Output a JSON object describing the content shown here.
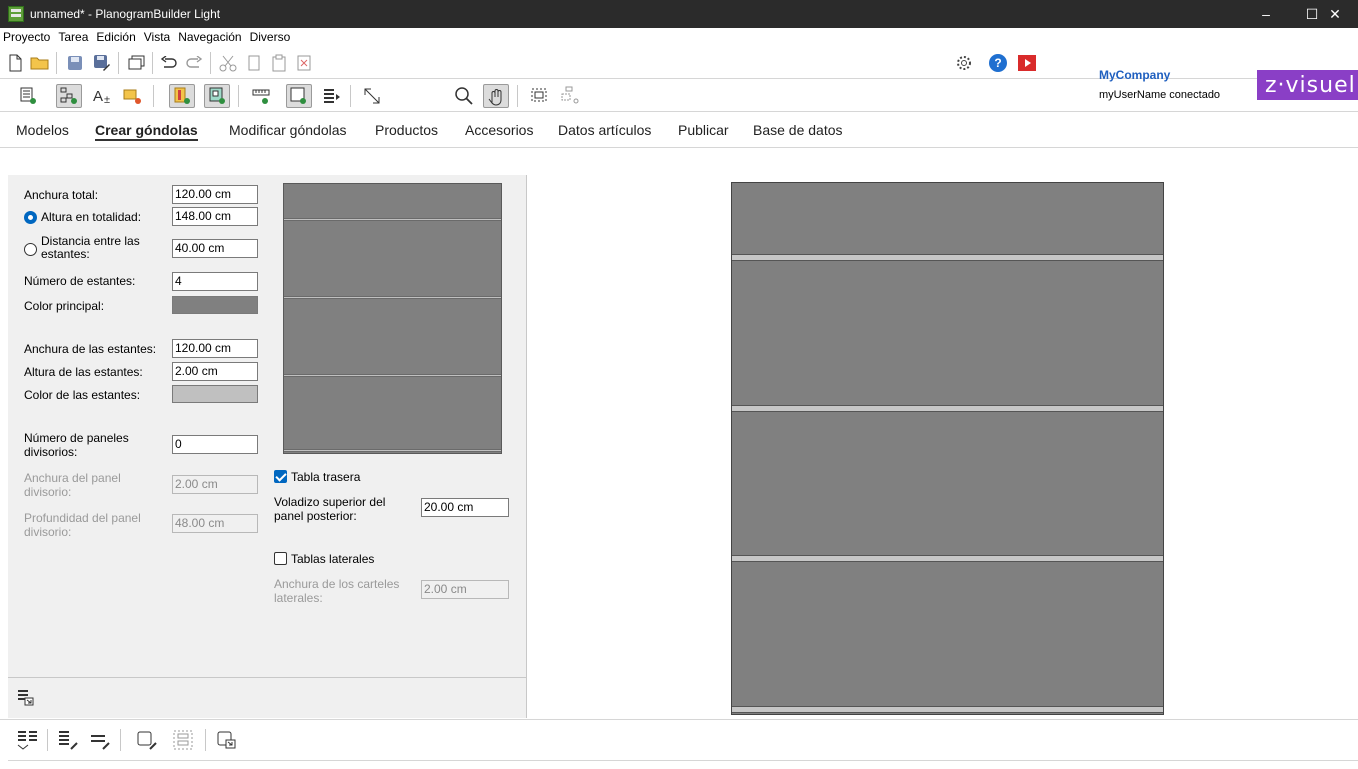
{
  "window": {
    "title": "unnamed* - PlanogramBuilder Light",
    "controls": {
      "minimize": "–",
      "maximize": "☐",
      "close": "✕"
    }
  },
  "menu": [
    "Proyecto",
    "Tarea",
    "Edición",
    "Vista",
    "Navegación",
    "Diverso"
  ],
  "company": {
    "name": "MyCompany",
    "user": "myUserName conectado",
    "logo": "z·visuel"
  },
  "tabs": [
    "Modelos",
    "Crear góndolas",
    "Modificar góndolas",
    "Productos",
    "Accesorios",
    "Datos artículos",
    "Publicar",
    "Base de datos"
  ],
  "active_tab": "Crear góndolas",
  "form": {
    "total_width_label": "Anchura total:",
    "total_width_value": "120.00 cm",
    "total_height_label": "Altura en totalidad:",
    "total_height_value": "148.00 cm",
    "shelf_distance_label_1": "Distancia entre las",
    "shelf_distance_label_2": "estantes:",
    "shelf_distance_value": "40.00 cm",
    "num_shelves_label": "Número de estantes:",
    "num_shelves_value": "4",
    "main_color_label": "Color principal:",
    "main_color": "#808080",
    "shelf_width_label": "Anchura de las estantes:",
    "shelf_width_value": "120.00 cm",
    "shelf_height_label": "Altura de las estantes:",
    "shelf_height_value": "2.00 cm",
    "shelf_color_label": "Color de las estantes:",
    "shelf_color": "#c0c0c0",
    "num_dividers_label_1": "Número de paneles",
    "num_dividers_label_2": "divisorios:",
    "num_dividers_value": "0",
    "divider_width_label_1": "Anchura del panel",
    "divider_width_label_2": "divisorio:",
    "divider_width_value": "2.00 cm",
    "divider_depth_label_1": "Profundidad del panel",
    "divider_depth_label_2": "divisorio:",
    "divider_depth_value": "48.00 cm",
    "back_board_label": "Tabla trasera",
    "overhang_label_1": "Voladizo superior del",
    "overhang_label_2": "panel posterior:",
    "overhang_value": "20.00 cm",
    "side_boards_label": "Tablas laterales",
    "side_width_label_1": "Anchura de los carteles",
    "side_width_label_2": "laterales:",
    "side_width_value": "2.00 cm"
  },
  "colors": {
    "titlebar": "#2b2b2b",
    "accent": "#0067c0",
    "company": "#1f5fbf",
    "logo_bg": "#8a3fc6"
  }
}
